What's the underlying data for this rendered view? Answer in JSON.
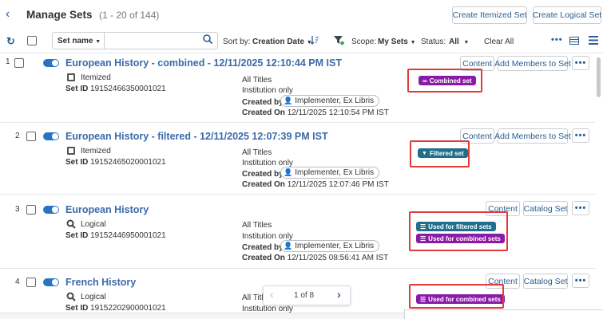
{
  "header": {
    "back_icon": "chevron-left-icon",
    "title": "Manage Sets",
    "count": "(1 - 20 of 144)",
    "create_itemized": "Create Itemized Set",
    "create_logical": "Create Logical Set"
  },
  "toolbar": {
    "refresh_icon": "refresh-icon",
    "search_field_select": "Set name",
    "search_placeholder": "",
    "search_icon": "search-icon",
    "sort_label": "Sort by:",
    "sort_value": "Creation Date",
    "sort_icon": "sort-direction-icon",
    "filter_icon": "filter-icon",
    "scope_label": "Scope:",
    "scope_value": "My Sets",
    "status_label": "Status:",
    "status_value": "All",
    "clear_all": "Clear All",
    "more_icon": "more-icon",
    "list_view_icon": "compact-view-icon",
    "menu_icon": "hamburger-icon"
  },
  "common": {
    "created_by": "Created by",
    "created_on": "Created On",
    "set_id": "Set ID",
    "more": "•••"
  },
  "rows": [
    {
      "num": "1",
      "title": "European History - combined - 12/11/2025 12:10:44 PM IST",
      "type": "Itemized",
      "set_id": "19152466350001021",
      "content": "All Titles",
      "scope": "Institution only",
      "creator": "Implementer, Ex Libris",
      "created_on": "12/11/2025 12:10:54 PM IST",
      "btn1": "Content",
      "btn2": "Add Members to Set",
      "badges": [
        "Combined set"
      ]
    },
    {
      "num": "2",
      "title": "European History - filtered - 12/11/2025 12:07:39 PM IST",
      "type": "Itemized",
      "set_id": "19152465020001021",
      "content": "All Titles",
      "scope": "Institution only",
      "creator": "Implementer, Ex Libris",
      "created_on": "12/11/2025 12:07:46 PM IST",
      "btn1": "Content",
      "btn2": "Add Members to Set",
      "badges": [
        "Filtered set"
      ]
    },
    {
      "num": "3",
      "title": "European History",
      "type": "Logical",
      "set_id": "19152446950001021",
      "content": "All Titles",
      "scope": "Institution only",
      "creator": "Implementer, Ex Libris",
      "created_on": "12/11/2025 08:56:41 AM IST",
      "btn1": "Content",
      "btn2": "Catalog Set",
      "badges": [
        "Used for filtered sets",
        "Used for combined sets"
      ]
    },
    {
      "num": "4",
      "title": "French History",
      "type": "Logical",
      "set_id": "19152202900001021",
      "content": "All Titl",
      "scope": "Institution only",
      "btn1": "Content",
      "btn2": "Catalog Set",
      "badges": [
        "Used for combined sets"
      ]
    }
  ],
  "pager": {
    "text": "1 of 8",
    "prev_icon": "chevron-left-icon",
    "next_icon": "chevron-right-icon"
  },
  "colors": {
    "purple": "#8a1ba8",
    "teal": "#1f6e8c",
    "accent": "#2a73c4",
    "highlight": "#e03a3a"
  }
}
